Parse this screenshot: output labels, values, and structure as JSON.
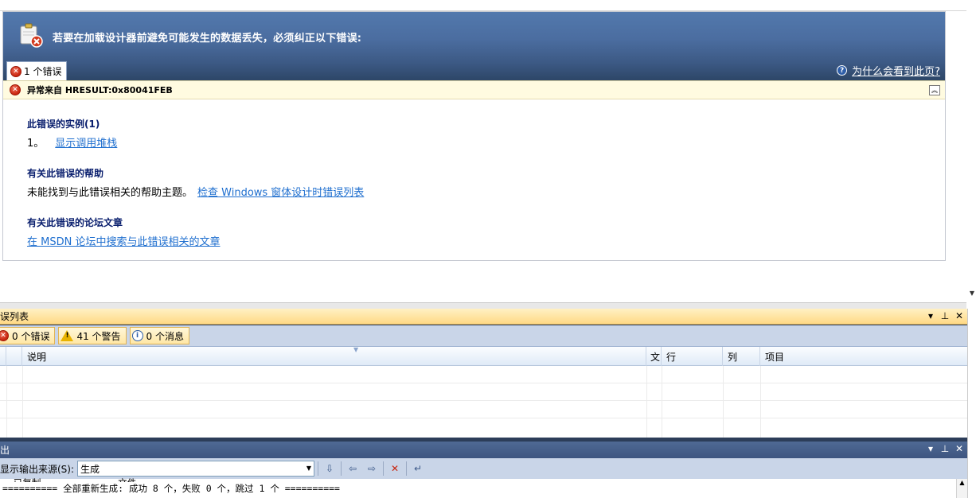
{
  "designer": {
    "header_text": "若要在加载设计器前避免可能发生的数据丢失，必须纠正以下错误:",
    "error_tab_label": "1 个错误",
    "why_link": "为什么会看到此页?",
    "exception_text": "异常来自 HRESULT:0x80041FEB",
    "collapse_icon": "︽",
    "sections": {
      "instances_title": "此错误的实例(1)",
      "instance_number": "1。",
      "instance_link": "显示调用堆栈",
      "help_title": "有关此错误的帮助",
      "help_text": "未能找到与此错误相关的帮助主题。",
      "help_link": "检查 Windows 窗体设计时错误列表",
      "forum_title": "有关此错误的论坛文章",
      "forum_link": "在 MSDN 论坛中搜索与此错误相关的文章"
    }
  },
  "error_list": {
    "title": "错误列表",
    "filters": [
      {
        "label": "0 个错误",
        "icon": "error-icon"
      },
      {
        "label": "41 个警告",
        "icon": "warning-icon"
      },
      {
        "label": "0 个消息",
        "icon": "info-icon"
      }
    ],
    "columns": [
      "说明",
      "文",
      "行",
      "列",
      "项目"
    ],
    "controls": [
      "▾",
      "ꟸ",
      "✕"
    ]
  },
  "output": {
    "title": "输出",
    "source_label": "显示输出来源(S):",
    "source_value": "生成",
    "cut_line": "  已复制              文件",
    "line": "========== 全部重新生成: 成功 8 个，失败 0 个，跳过 1 个 =========="
  },
  "colors": {
    "header_blue": "#4b6da0",
    "exception_bg": "#fffbe0",
    "link_blue": "#1f6fcf",
    "section_title": "#0a1f6e",
    "pane_title_gold": "#ffd985"
  }
}
